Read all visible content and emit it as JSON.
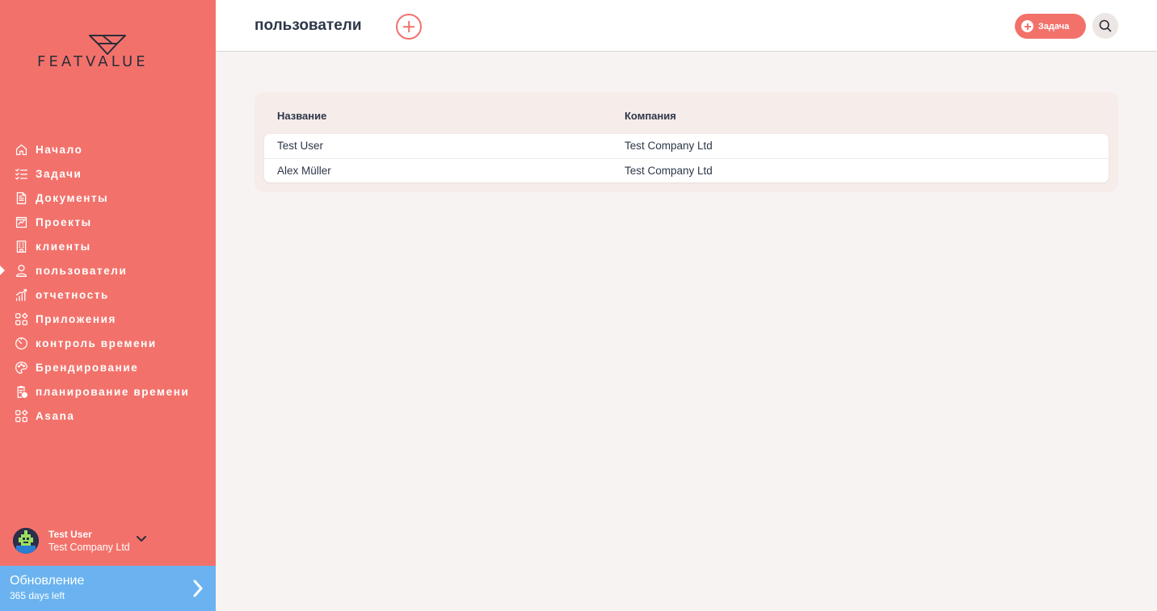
{
  "sidebar": {
    "logo_text": "FEATVALUE",
    "items": [
      {
        "label": "Начало",
        "icon": "home-icon"
      },
      {
        "label": "Задачи",
        "icon": "tasks-icon"
      },
      {
        "label": "Документы",
        "icon": "document-icon"
      },
      {
        "label": "Проекты",
        "icon": "projects-icon"
      },
      {
        "label": "клиенты",
        "icon": "building-icon"
      },
      {
        "label": "пользователи",
        "icon": "user-icon",
        "active": true
      },
      {
        "label": "отчетность",
        "icon": "reporting-icon"
      },
      {
        "label": "Приложения",
        "icon": "apps-icon"
      },
      {
        "label": "контроль времени",
        "icon": "timer-icon"
      },
      {
        "label": "Брендирование",
        "icon": "palette-icon"
      },
      {
        "label": "планирование времени",
        "icon": "schedule-icon"
      },
      {
        "label": "Asana",
        "icon": "apps-icon"
      }
    ],
    "user": {
      "name": "Test User",
      "company": "Test Company Ltd"
    },
    "upgrade": {
      "title": "Обновление",
      "subtitle": "365 days left"
    }
  },
  "header": {
    "title": "пользователи",
    "task_button_label": "Задача"
  },
  "table": {
    "columns": [
      "Название",
      "Компания"
    ],
    "rows": [
      {
        "name": "Test User",
        "company": "Test Company Ltd"
      },
      {
        "name": "Alex Müller",
        "company": "Test Company Ltd"
      }
    ]
  },
  "colors": {
    "sidebar": "#f2726b",
    "accent": "#f2726b",
    "upgrade": "#6ab3f0",
    "background": "#f6f3f2"
  }
}
